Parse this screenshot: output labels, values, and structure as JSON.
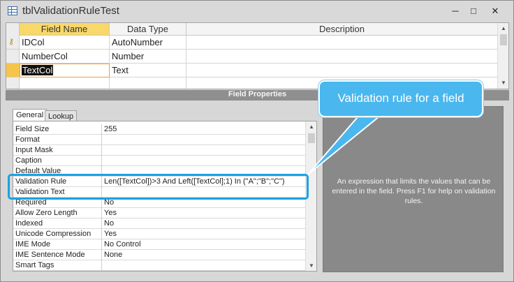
{
  "window": {
    "title": "tblValidationRuleTest",
    "minimize": "─",
    "maximize": "□",
    "close": "✕"
  },
  "grid": {
    "headers": [
      "Field Name",
      "Data Type",
      "Description"
    ],
    "rows": [
      {
        "field_name": "IDCol",
        "data_type": "AutoNumber",
        "primary_key": true
      },
      {
        "field_name": "NumberCol",
        "data_type": "Number"
      },
      {
        "field_name": "TextCol",
        "data_type": "Text",
        "current": true
      }
    ]
  },
  "field_properties_label": "Field Properties",
  "tabs": {
    "general": "General",
    "lookup": "Lookup"
  },
  "properties": [
    {
      "name": "Field Size",
      "value": "255"
    },
    {
      "name": "Format",
      "value": ""
    },
    {
      "name": "Input Mask",
      "value": ""
    },
    {
      "name": "Caption",
      "value": ""
    },
    {
      "name": "Default Value",
      "value": ""
    },
    {
      "name": "Validation Rule",
      "value": "Len([TextCol])>3 And Left([TextCol];1) In (\"A\";\"B\";\"C\")"
    },
    {
      "name": "Validation Text",
      "value": ""
    },
    {
      "name": "Required",
      "value": "No"
    },
    {
      "name": "Allow Zero Length",
      "value": "Yes"
    },
    {
      "name": "Indexed",
      "value": "No"
    },
    {
      "name": "Unicode Compression",
      "value": "Yes"
    },
    {
      "name": "IME Mode",
      "value": "No Control"
    },
    {
      "name": "IME Sentence Mode",
      "value": "None"
    },
    {
      "name": "Smart Tags",
      "value": ""
    }
  ],
  "help_text": "An expression that limits the values that can be entered in the field. Press F1 for help on validation rules.",
  "callout": "Validation rule for a field",
  "colors": {
    "callout": "#4ab7ee",
    "highlight": "#1ba1e2",
    "active_header": "#f9d86a"
  }
}
